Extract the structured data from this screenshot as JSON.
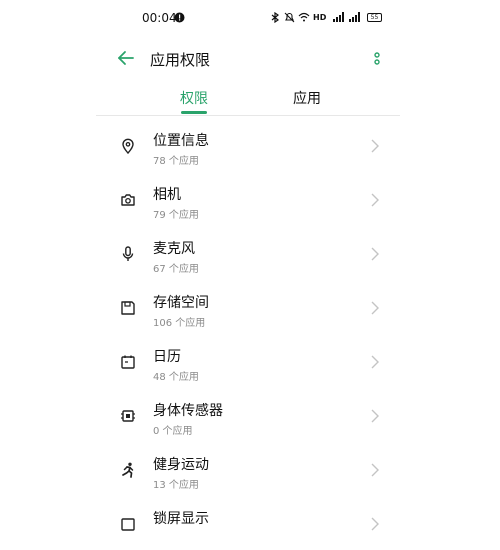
{
  "status_bar": {
    "time": "00:04",
    "network": "HD",
    "battery": "55"
  },
  "header": {
    "title": "应用权限",
    "back_icon": "arrow-left-icon",
    "more_icon": "more-vertical-icon"
  },
  "tabs": [
    {
      "label": "权限",
      "active": true
    },
    {
      "label": "应用",
      "active": false
    }
  ],
  "colors": {
    "accent": "#2aa36b",
    "secondary_text": "#8b8b8b"
  },
  "permissions": [
    {
      "name": "位置信息",
      "count": "78 个应用",
      "icon": "location-pin-icon"
    },
    {
      "name": "相机",
      "count": "79 个应用",
      "icon": "camera-icon"
    },
    {
      "name": "麦克风",
      "count": "67 个应用",
      "icon": "microphone-icon"
    },
    {
      "name": "存储空间",
      "count": "106 个应用",
      "icon": "storage-icon"
    },
    {
      "name": "日历",
      "count": "48 个应用",
      "icon": "calendar-icon"
    },
    {
      "name": "身体传感器",
      "count": "0 个应用",
      "icon": "sensor-chip-icon"
    },
    {
      "name": "健身运动",
      "count": "13 个应用",
      "icon": "running-icon"
    },
    {
      "name": "锁屏显示",
      "count": "",
      "icon": "lock-screen-icon"
    }
  ]
}
